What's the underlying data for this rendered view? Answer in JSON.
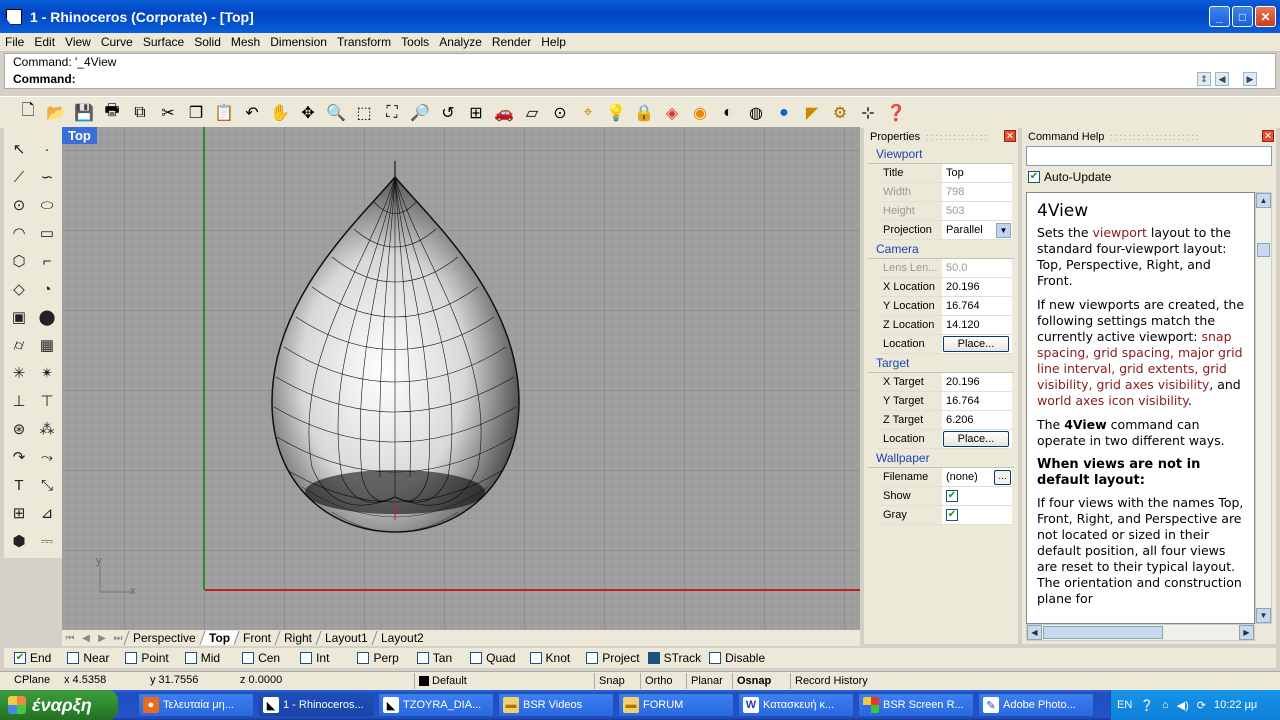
{
  "window": {
    "title": "1 - Rhinoceros (Corporate) - [Top]"
  },
  "menu": [
    "File",
    "Edit",
    "View",
    "Curve",
    "Surface",
    "Solid",
    "Mesh",
    "Dimension",
    "Transform",
    "Tools",
    "Analyze",
    "Render",
    "Help"
  ],
  "command": {
    "history": "Command: '_4View",
    "prompt": "Command:"
  },
  "viewport": {
    "title": "Top",
    "axis_y": "y",
    "axis_x": "x",
    "grid_color": "#a0a0a0",
    "x_axis_color": "#c02020",
    "y_axis_color": "#2a8a2a"
  },
  "view_tabs": [
    "Perspective",
    "Top",
    "Front",
    "Right",
    "Layout1",
    "Layout2"
  ],
  "active_tab": "Top",
  "properties": {
    "panel_title": "Properties",
    "viewport_section": "Viewport",
    "title_label": "Title",
    "title_value": "Top",
    "width_label": "Width",
    "width_value": "798",
    "height_label": "Height",
    "height_value": "503",
    "projection_label": "Projection",
    "projection_value": "Parallel",
    "camera_section": "Camera",
    "lens_label": "Lens Len...",
    "lens_value": "50.0",
    "xloc_label": "X Location",
    "xloc_value": "20.196",
    "yloc_label": "Y Location",
    "yloc_value": "16.764",
    "zloc_label": "Z Location",
    "zloc_value": "14.120",
    "location_label": "Location",
    "place_button": "Place...",
    "target_section": "Target",
    "xtgt_label": "X Target",
    "xtgt_value": "20.196",
    "ytgt_label": "Y Target",
    "ytgt_value": "16.764",
    "ztgt_label": "Z Target",
    "ztgt_value": "6.206",
    "tlocation_label": "Location",
    "tplace_button": "Place...",
    "wallpaper_section": "Wallpaper",
    "filename_label": "Filename",
    "filename_value": "(none)",
    "browse_button": "...",
    "show_label": "Show",
    "gray_label": "Gray"
  },
  "help": {
    "panel_title": "Command Help",
    "auto_update": "Auto-Update",
    "heading": "4View",
    "p1_a": "Sets the ",
    "p1_link": "viewport",
    "p1_b": " layout to the standard four-viewport layout: Top, Perspective, Right, and Front.",
    "p2_a": "If new viewports are created, the following settings match the currently active viewport: ",
    "p2_links": "snap spacing, grid spacing, major grid line interval, grid extents, grid visibility, grid axes visibility",
    "p2_b": ", and ",
    "p2_link2": "world axes icon visibility",
    "p2_c": ".",
    "p3_a": "The ",
    "p3_bold": "4View",
    "p3_b": " command can operate in two different ways.",
    "h2": "When views are not in default layout:",
    "p4": "If four views with the names Top, Front, Right, and Perspective are not located or sized in their default position, all four views are reset to their typical layout. The orientation and construction plane for"
  },
  "osnap": [
    {
      "label": "End",
      "checked": true
    },
    {
      "label": "Near",
      "checked": false
    },
    {
      "label": "Point",
      "checked": false
    },
    {
      "label": "Mid",
      "checked": false
    },
    {
      "label": "Cen",
      "checked": false
    },
    {
      "label": "Int",
      "checked": false
    },
    {
      "label": "Perp",
      "checked": false
    },
    {
      "label": "Tan",
      "checked": false
    },
    {
      "label": "Quad",
      "checked": false
    },
    {
      "label": "Knot",
      "checked": false
    },
    {
      "label": "Project",
      "checked": false
    },
    {
      "label": "STrack",
      "checked": true
    },
    {
      "label": "Disable",
      "checked": false
    }
  ],
  "status": {
    "cplane": "CPlane",
    "x": "x 4.5358",
    "y": "y 31.7556",
    "z": "z 0.0000",
    "layer": "Default",
    "snap": "Snap",
    "ortho": "Ortho",
    "planar": "Planar",
    "osnap": "Osnap",
    "record": "Record History"
  },
  "taskbar": {
    "start": "έναρξη",
    "tasks": [
      "Τελευταία μη...",
      "1 - Rhinoceros...",
      "TZOYRA_DIA...",
      "BSR Videos",
      "FORUM",
      "Κατασκευή κ...",
      "BSR Screen R...",
      "Adobe Photo..."
    ],
    "lang": "EN",
    "clock": "10:22 μμ"
  }
}
